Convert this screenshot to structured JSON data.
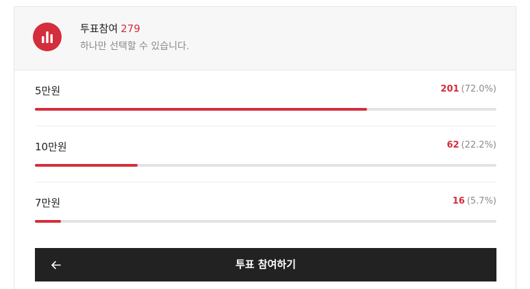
{
  "poll": {
    "title": "투표참여",
    "participant_count": "279",
    "subtitle": "하나만 선택할 수 있습니다.",
    "submit_label": "투표 참여하기",
    "icon": "poll-chart-icon",
    "back_icon": "arrow-left-icon",
    "accent_color": "#d42d3b",
    "options": [
      {
        "label": "5만원",
        "votes": "201",
        "percent": "(72.0%)",
        "fraction": 0.72
      },
      {
        "label": "10만원",
        "votes": "62",
        "percent": "(22.2%)",
        "fraction": 0.222
      },
      {
        "label": "7만원",
        "votes": "16",
        "percent": "(5.7%)",
        "fraction": 0.057
      }
    ]
  }
}
